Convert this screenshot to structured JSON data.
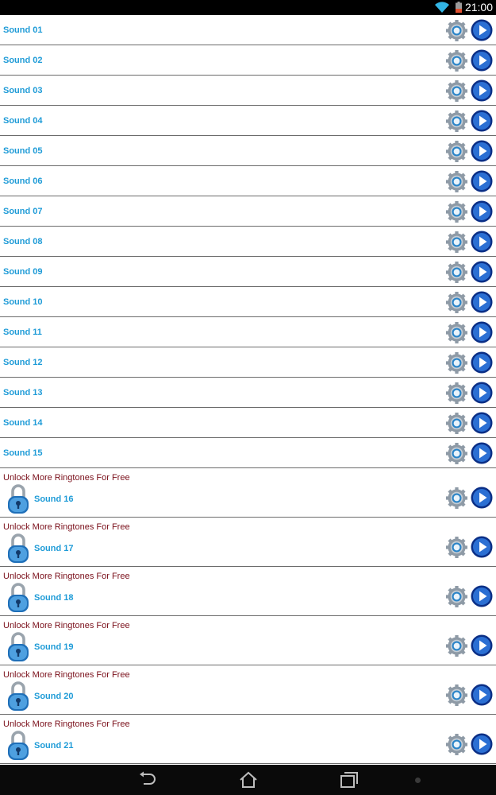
{
  "status_bar": {
    "time": "21:00",
    "icons": [
      "wifi-icon",
      "battery-icon"
    ]
  },
  "list": {
    "play_icon": "play-icon",
    "settings_icon": "gear-icon",
    "lock_icon": "padlock-icon",
    "free_items": [
      {
        "label": "Sound 01"
      },
      {
        "label": "Sound 02"
      },
      {
        "label": "Sound 03"
      },
      {
        "label": "Sound 04"
      },
      {
        "label": "Sound 05"
      },
      {
        "label": "Sound 06"
      },
      {
        "label": "Sound 07"
      },
      {
        "label": "Sound 08"
      },
      {
        "label": "Sound 09"
      },
      {
        "label": "Sound 10"
      },
      {
        "label": "Sound 11"
      },
      {
        "label": "Sound 12"
      },
      {
        "label": "Sound 13"
      },
      {
        "label": "Sound 14"
      },
      {
        "label": "Sound 15"
      }
    ],
    "locked_items": [
      {
        "unlock_text": "Unlock More Ringtones For Free",
        "label": "Sound 16"
      },
      {
        "unlock_text": "Unlock More Ringtones For Free",
        "label": "Sound 17"
      },
      {
        "unlock_text": "Unlock More Ringtones For Free",
        "label": "Sound 18"
      },
      {
        "unlock_text": "Unlock More Ringtones For Free",
        "label": "Sound 19"
      },
      {
        "unlock_text": "Unlock More Ringtones For Free",
        "label": "Sound 20"
      },
      {
        "unlock_text": "Unlock More Ringtones For Free",
        "label": "Sound 21"
      }
    ]
  },
  "nav_bar": {
    "buttons": [
      "back-icon",
      "home-icon",
      "recent-apps-icon"
    ]
  },
  "colors": {
    "title_blue": "#1e9bd7",
    "unlock_red": "#7a0f1a",
    "divider": "#6b6b6b"
  }
}
